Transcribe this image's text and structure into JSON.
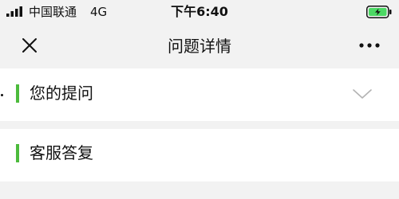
{
  "status_bar": {
    "carrier": "中国联通",
    "network": "4G",
    "time": "下午6:40",
    "battery_icon": "battery-charging-icon",
    "signal_icon": "signal-bars-icon"
  },
  "nav": {
    "title": "问题详情",
    "close_icon": "close-icon",
    "more_icon": "more-horizontal-icon"
  },
  "sections": [
    {
      "label": "您的提问",
      "expand_icon": "chevron-down-icon"
    },
    {
      "label": "客服答复"
    }
  ],
  "colors": {
    "accent": "#4cbb3c",
    "battery": "#4cd964",
    "background": "#f2f2f2",
    "card": "#ffffff"
  }
}
